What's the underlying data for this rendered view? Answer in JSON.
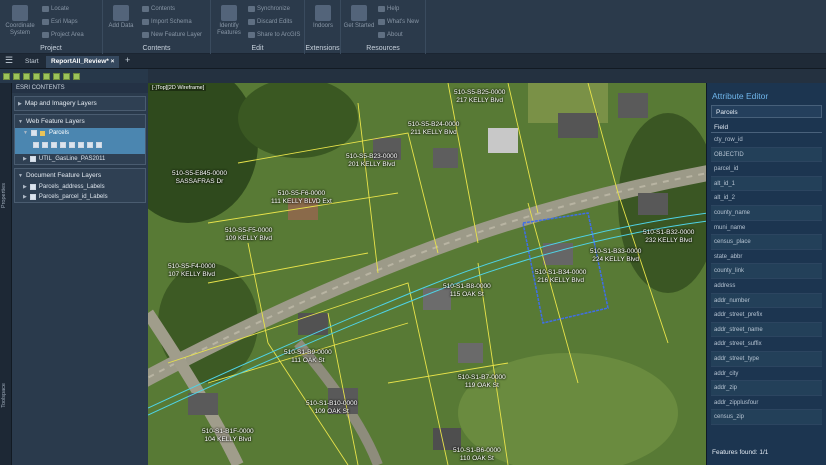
{
  "ribbon": {
    "groups": [
      {
        "label": "Project",
        "buttons": [
          "Coordinate System",
          "Locate",
          "Esri Maps",
          "Project Area"
        ]
      },
      {
        "label": "Contents",
        "buttons": [
          "Add Data",
          "Contents",
          "Import Schema",
          "New Feature Layer"
        ]
      },
      {
        "label": "Edit",
        "buttons": [
          "Identify Features",
          "Synchronize",
          "Discard Edits",
          "Share to ArcGIS"
        ]
      },
      {
        "label": "Extensions",
        "buttons": [
          "Indoors"
        ]
      },
      {
        "label": "Resources",
        "buttons": [
          "Get Started",
          "Help",
          "What's New",
          "About"
        ]
      }
    ]
  },
  "tabs": {
    "start": "Start",
    "active": "ReportAll_Review*",
    "close": "×",
    "add": "+"
  },
  "side_rail": {
    "properties": "Properties",
    "toolspace": "Toolspace"
  },
  "contents_panel": {
    "title": "ESRI CONTENTS",
    "sections": [
      {
        "title": "Map and Imagery Layers",
        "items": []
      },
      {
        "title": "Web Feature Layers",
        "items": [
          "Parcels",
          "UTIL_GasLine_PAS2011"
        ]
      },
      {
        "title": "Document Feature Layers",
        "items": [
          "Parcels_address_Labels",
          "Parcels_parcel_id_Labels"
        ]
      }
    ]
  },
  "map": {
    "viewport_label": "[-]Top][2D Wireframe]",
    "parcels": [
      {
        "id": "510-S5-B25-0000",
        "addr": "217 KELLY Blvd"
      },
      {
        "id": "510-S5-B24-0000",
        "addr": "211 KELLY Blvd"
      },
      {
        "id": "510-S5-B23-0000",
        "addr": "201 KELLY Blvd"
      },
      {
        "id": "510-S5-E845-0000",
        "addr": "SASSAFRAS Dr"
      },
      {
        "id": "510-S5-F6-0000",
        "addr": "111 KELLY BLVD Ext"
      },
      {
        "id": "510-S5-F5-0000",
        "addr": "109 KELLY Blvd"
      },
      {
        "id": "510-S5-F4-0000",
        "addr": "107 KELLY Blvd"
      },
      {
        "id": "510-S1-B32-0000",
        "addr": "232 KELLY Blvd"
      },
      {
        "id": "510-S1-B33-0000",
        "addr": "224 KELLY Blvd"
      },
      {
        "id": "510-S1-B34-0000",
        "addr": "216 KELLY Blvd"
      },
      {
        "id": "510-S1-B8-0000",
        "addr": "115 OAK St"
      },
      {
        "id": "510-S1-B9-0000",
        "addr": "111 OAK St"
      },
      {
        "id": "510-S1-B7-0000",
        "addr": "119 OAK St"
      },
      {
        "id": "510-S1-B10-0000",
        "addr": "109 OAK St"
      },
      {
        "id": "510-S1-B1F-0000",
        "addr": "104 KELLY Blvd"
      },
      {
        "id": "510-S1-B6-0000",
        "addr": "110 OAK St"
      }
    ]
  },
  "attribute_editor": {
    "title": "Attribute Editor",
    "layer": "Parcels",
    "field_header": "Field",
    "fields": [
      "cty_row_id",
      "OBJECTID",
      "parcel_id",
      "alt_id_1",
      "alt_id_2",
      "county_name",
      "muni_name",
      "census_place",
      "state_abbr",
      "county_link",
      "address",
      "addr_number",
      "addr_street_prefix",
      "addr_street_name",
      "addr_street_suffix",
      "addr_street_type",
      "addr_city",
      "addr_zip",
      "addr_zipplusfour",
      "census_zip"
    ],
    "found": "Features found: 1/1"
  },
  "colors": {
    "accent": "#6fb5ea",
    "selection": "#4b86b0",
    "parcel_line": "#e8e34a",
    "selected_parcel": "#3f6ee8",
    "gas_line": "#4fd3e6"
  }
}
